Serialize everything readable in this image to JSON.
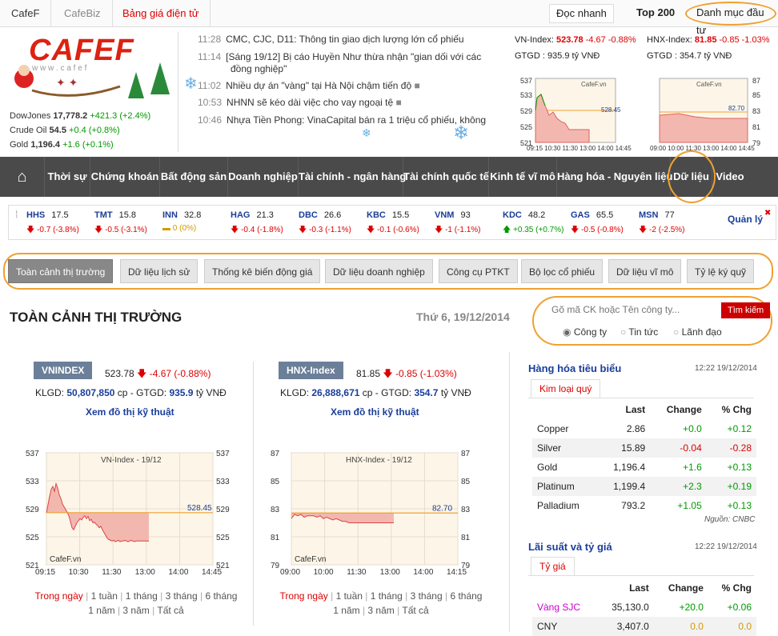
{
  "topbar": {
    "tabs": [
      "CafeF",
      "CafeBiz",
      "Bảng giá điện tử"
    ],
    "right": [
      "Đọc nhanh",
      "Top 200",
      "Danh mục đầu tư"
    ]
  },
  "logo": {
    "text": "CAFEF",
    "sub": "w w w . c a f e f"
  },
  "markets": [
    {
      "name": "DowJones",
      "value": "17,778.2",
      "change": "+421.3 (+2.4%)"
    },
    {
      "name": "Crude Oil",
      "value": "54.5",
      "change": "+0.4 (+0.8%)"
    },
    {
      "name": "Gold",
      "value": "1,196.4",
      "change": "+1.6 (+0.1%)"
    }
  ],
  "news": [
    {
      "time": "11:28",
      "text": "CMC, CJC, D11: Thông tin giao dịch lượng lớn cổ phiếu"
    },
    {
      "time": "11:14",
      "text": "[Sáng 19/12] Bị cáo Huyền Như thừa nhận \"gian dối với các",
      "text2": "đồng nghiệp\""
    },
    {
      "time": "11:02",
      "text": "Nhiều dự án \"vàng\" tại Hà Nội chậm tiến độ"
    },
    {
      "time": "10:53",
      "text": "NHNN sẽ kéo dài việc cho vay ngoại tệ"
    },
    {
      "time": "10:46",
      "text": "Nhựa Tiền Phong: VinaCapital bán ra 1 triệu cổ phiếu, không"
    }
  ],
  "header_idx": {
    "vn": {
      "label": "VN-Index:",
      "value": "523.78",
      "change": "-4.67 -0.88%",
      "gtgd": "GTGD : 935.9 tỷ VNĐ"
    },
    "hnx": {
      "label": "HNX-Index:",
      "value": "81.85",
      "change": "-0.85 -1.03%",
      "gtgd": "GTGD : 354.7 tỷ VNĐ"
    }
  },
  "nav": [
    "Thời sự",
    "Chứng khoán",
    "Bất động sản",
    "Doanh nghiệp",
    "Tài chính - ngân hàng",
    "Tài chính quốc tế",
    "Kinh tế vĩ mô",
    "Hàng hóa - Nguyên liệu",
    "Dữ liệu",
    "Video"
  ],
  "ticker": [
    {
      "s": "HHS",
      "p": "17.5",
      "c": "-0.7 (-3.8%)",
      "d": "dn"
    },
    {
      "s": "TMT",
      "p": "15.8",
      "c": "-0.5 (-3.1%)",
      "d": "dn"
    },
    {
      "s": "INN",
      "p": "32.8",
      "c": "0 (0%)",
      "d": "eq"
    },
    {
      "s": "HAG",
      "p": "21.3",
      "c": "-0.4 (-1.8%)",
      "d": "dn"
    },
    {
      "s": "DBC",
      "p": "26.6",
      "c": "-0.3 (-1.1%)",
      "d": "dn"
    },
    {
      "s": "KBC",
      "p": "15.5",
      "c": "-0.1 (-0.6%)",
      "d": "dn"
    },
    {
      "s": "VNM",
      "p": "93",
      "c": "-1 (-1.1%)",
      "d": "dn"
    },
    {
      "s": "KDC",
      "p": "48.2",
      "c": "+0.35 (+0.7%)",
      "d": "up"
    },
    {
      "s": "GAS",
      "p": "65.5",
      "c": "-0.5 (-0.8%)",
      "d": "dn"
    },
    {
      "s": "MSN",
      "p": "77",
      "c": "-2 (-2.5%)",
      "d": "dn"
    }
  ],
  "ticker_manage": "Quản lý",
  "tabs": [
    "Toàn cảnh thị trường",
    "Dữ liệu lịch sử",
    "Thống kê biến động giá",
    "Dữ liệu doanh nghiệp",
    "Công cụ PTKT",
    "Bộ lọc cổ phiếu",
    "Dữ liệu vĩ mô",
    "Tỷ lệ ký quỹ"
  ],
  "page_title": "TOÀN CẢNH THỊ TRƯỜNG",
  "page_date": "Thứ 6, 19/12/2014",
  "search": {
    "placeholder": "Gõ mã CK hoặc Tên công ty...",
    "button": "Tìm kiếm",
    "options": [
      "Công ty",
      "Tin tức",
      "Lãnh đạo"
    ]
  },
  "panels": [
    {
      "name": "VNINDEX",
      "value": "523.78",
      "change": "-4.67 (-0.88%)",
      "klgd": "KLGD:",
      "klgd_v": "50,807,850",
      "gtgd": "cp - GTGD:",
      "gtgd_v": "935.9",
      "unit": "tỷ VNĐ",
      "link": "Xem đồ thị kỹ thuật"
    },
    {
      "name": "HNX-Index",
      "value": "81.85",
      "change": "-0.85 (-1.03%)",
      "klgd": "KLGD:",
      "klgd_v": "26,888,671",
      "gtgd": "cp - GTGD:",
      "gtgd_v": "354.7",
      "unit": "tỷ VNĐ",
      "link": "Xem đồ thị kỹ thuật"
    }
  ],
  "ranges": [
    "Trong ngày",
    "1 tuần",
    "1 tháng",
    "3 tháng",
    "6 tháng",
    "1 năm",
    "3 năm",
    "Tất cả"
  ],
  "chart_data": [
    {
      "type": "area",
      "title": "VN-Index - 19/12",
      "x": [
        "09:15",
        "10:30",
        "11:30",
        "13:00",
        "14:00",
        "14:45"
      ],
      "y_ticks": [
        521,
        525,
        529,
        533,
        537
      ],
      "ylim": [
        521,
        537
      ],
      "ref": 528.45,
      "ref_label": "528.45",
      "watermark": "CafeF.vn",
      "series": [
        {
          "x": [
            0,
            2,
            4,
            6,
            8,
            10,
            12,
            14,
            16,
            18,
            20,
            22,
            24,
            26,
            28,
            30,
            32,
            34,
            36,
            38,
            40,
            42,
            44,
            46,
            48,
            50,
            52,
            54,
            56,
            58,
            60,
            62,
            64,
            66,
            68,
            70,
            72,
            74,
            76,
            78,
            80,
            82,
            84,
            86,
            88,
            90,
            92,
            94,
            96,
            98,
            100,
            102,
            104,
            106,
            108,
            110,
            112,
            114,
            116,
            118,
            120,
            122,
            124,
            126,
            128
          ],
          "values": [
            528.4,
            529.6,
            530.8,
            531.8,
            532.2,
            531.5,
            532.6,
            532.0,
            531.0,
            530.5,
            529.7,
            529.3,
            528.9,
            528.5,
            528.0,
            527.2,
            526.3,
            526.0,
            526.5,
            527.0,
            527.3,
            527.6,
            527.4,
            527.8,
            528.0,
            527.6,
            527.9,
            527.3,
            527.5,
            527.0,
            527.1,
            526.8,
            526.6,
            526.3,
            526.5,
            526.0,
            525.6,
            525.2,
            524.8,
            524.6,
            524.5,
            524.4,
            524.5,
            524.3,
            524.4,
            524.5,
            524.3,
            524.4,
            524.4,
            524.5,
            524.4,
            524.3,
            524.4,
            524.5,
            524.4,
            524.3,
            524.4,
            524.4,
            524.4,
            524.4,
            524.4,
            524.4,
            524.4,
            524.4,
            524.4
          ]
        }
      ]
    },
    {
      "type": "area",
      "title": "HNX-Index - 19/12",
      "x": [
        "09:00",
        "10:00",
        "11:30",
        "13:00",
        "14:00",
        "14:15"
      ],
      "y_ticks": [
        79,
        81,
        83,
        85,
        87
      ],
      "ylim": [
        79,
        87
      ],
      "ref": 82.7,
      "ref_label": "82.70",
      "watermark": "CafeF.vn",
      "series": [
        {
          "x": [
            0,
            4,
            8,
            12,
            16,
            20,
            24,
            28,
            32,
            36,
            40,
            44,
            48,
            52,
            56,
            60,
            64,
            68,
            72,
            76,
            80,
            84,
            88,
            92,
            96,
            100,
            104,
            108,
            112,
            116,
            120,
            124,
            128
          ],
          "values": [
            82.3,
            82.6,
            82.5,
            82.6,
            82.4,
            82.5,
            82.5,
            82.5,
            82.4,
            82.5,
            82.3,
            82.4,
            82.3,
            82.2,
            82.3,
            82.2,
            82.1,
            82.1,
            82.0,
            82.0,
            82.0,
            82.0,
            82.0,
            82.0,
            82.0,
            82.0,
            82.0,
            82.0,
            82.0,
            82.0,
            82.0,
            82.0,
            82.0
          ]
        }
      ]
    }
  ],
  "commodities": {
    "title": "Hàng hóa tiêu biểu",
    "time": "12:22 19/12/2014",
    "tab": "Kim loại quý",
    "headers": [
      "Last",
      "Change",
      "% Chg"
    ],
    "rows": [
      [
        "Copper",
        "2.86",
        "+0.0",
        "+0.12"
      ],
      [
        "Silver",
        "15.89",
        "-0.04",
        "-0.28"
      ],
      [
        "Gold",
        "1,196.4",
        "+1.6",
        "+0.13"
      ],
      [
        "Platinum",
        "1,199.4",
        "+2.3",
        "+0.19"
      ],
      [
        "Palladium",
        "793.2",
        "+1.05",
        "+0.13"
      ]
    ],
    "source": "Nguồn: CNBC"
  },
  "rates": {
    "title": "Lãi suất và tỷ giá",
    "time": "12:22 19/12/2014",
    "tab": "Tỷ giá",
    "headers": [
      "Last",
      "Change",
      "% Chg"
    ],
    "rows": [
      [
        "Vàng SJC",
        "35,130.0",
        "+20.0",
        "+0.06"
      ],
      [
        "CNY",
        "3,407.0",
        "0.0",
        "0.0"
      ]
    ]
  },
  "colors": {
    "accent": "#d00",
    "orange": "#f0a030",
    "nav": "#4a4a4a"
  }
}
